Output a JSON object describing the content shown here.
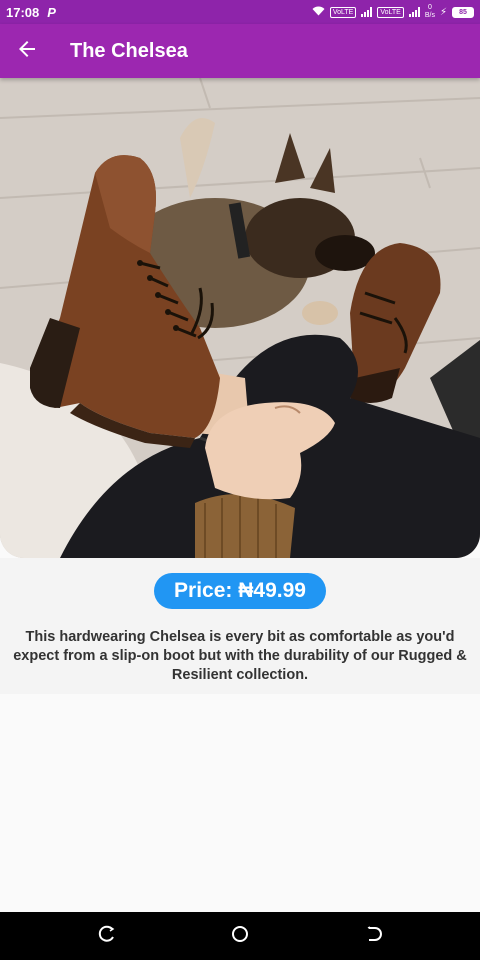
{
  "status_bar": {
    "time": "17:08",
    "notification_letter": "P",
    "network_chip_1": "VoLTE",
    "network_chip_2": "VoLTE",
    "speed_value": "0",
    "speed_unit": "B/s",
    "battery": "85"
  },
  "app_bar": {
    "title": "The Chelsea",
    "back_icon": "arrow-back-icon"
  },
  "product": {
    "image_alt": "Brown leather lace-up boot with dog in background",
    "price_label": "Price: ₦49.99",
    "description": "This hardwearing Chelsea is every bit as comfortable as you'd expect from a slip-on boot but with the durability of our Rugged & Resilient collection."
  },
  "nav_bar": {
    "icons": [
      "recent-apps-icon",
      "home-icon",
      "back-icon"
    ]
  },
  "colors": {
    "status_bar": "#8e24aa",
    "app_bar": "#9c27b0",
    "price_badge": "#2196f3",
    "background": "#fafafa",
    "details_background": "#f4f4f4"
  }
}
